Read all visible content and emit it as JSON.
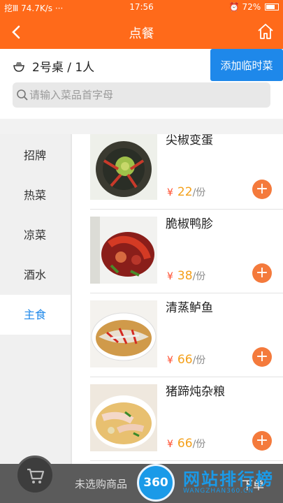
{
  "status_bar": {
    "carrier": "挖Ⅲ",
    "speed": "74.7K/s",
    "time": "17:56",
    "battery": "72%"
  },
  "nav": {
    "title": "点餐",
    "back_icon": "chevron-left-icon",
    "home_icon": "home-icon"
  },
  "table": {
    "info": "2号桌 / 1人",
    "add_temp_label": "添加临时菜"
  },
  "search": {
    "placeholder": "请输入菜品首字母"
  },
  "categories": [
    {
      "label": "招牌",
      "active": false
    },
    {
      "label": "热菜",
      "active": false
    },
    {
      "label": "凉菜",
      "active": false
    },
    {
      "label": "酒水",
      "active": false
    },
    {
      "label": "主食",
      "active": true
    }
  ],
  "dishes": [
    {
      "name": "尖椒变蛋",
      "currency": "¥",
      "price": "22",
      "unit": "/份"
    },
    {
      "name": "脆椒鸭胗",
      "currency": "¥",
      "price": "38",
      "unit": "/份"
    },
    {
      "name": "清蒸鲈鱼",
      "currency": "¥",
      "price": "66",
      "unit": "/份"
    },
    {
      "name": "猪蹄炖杂粮",
      "currency": "¥",
      "price": "66",
      "unit": "/份"
    }
  ],
  "bottom": {
    "no_items": "未选购商品",
    "checkout": "下单"
  },
  "watermark": {
    "badge": "360",
    "title": "网站排行榜",
    "url": "WANGZHAN360.CN"
  },
  "colors": {
    "accent": "#ff6a1a",
    "blue": "#1e88ea",
    "price": "#f4a01a"
  }
}
